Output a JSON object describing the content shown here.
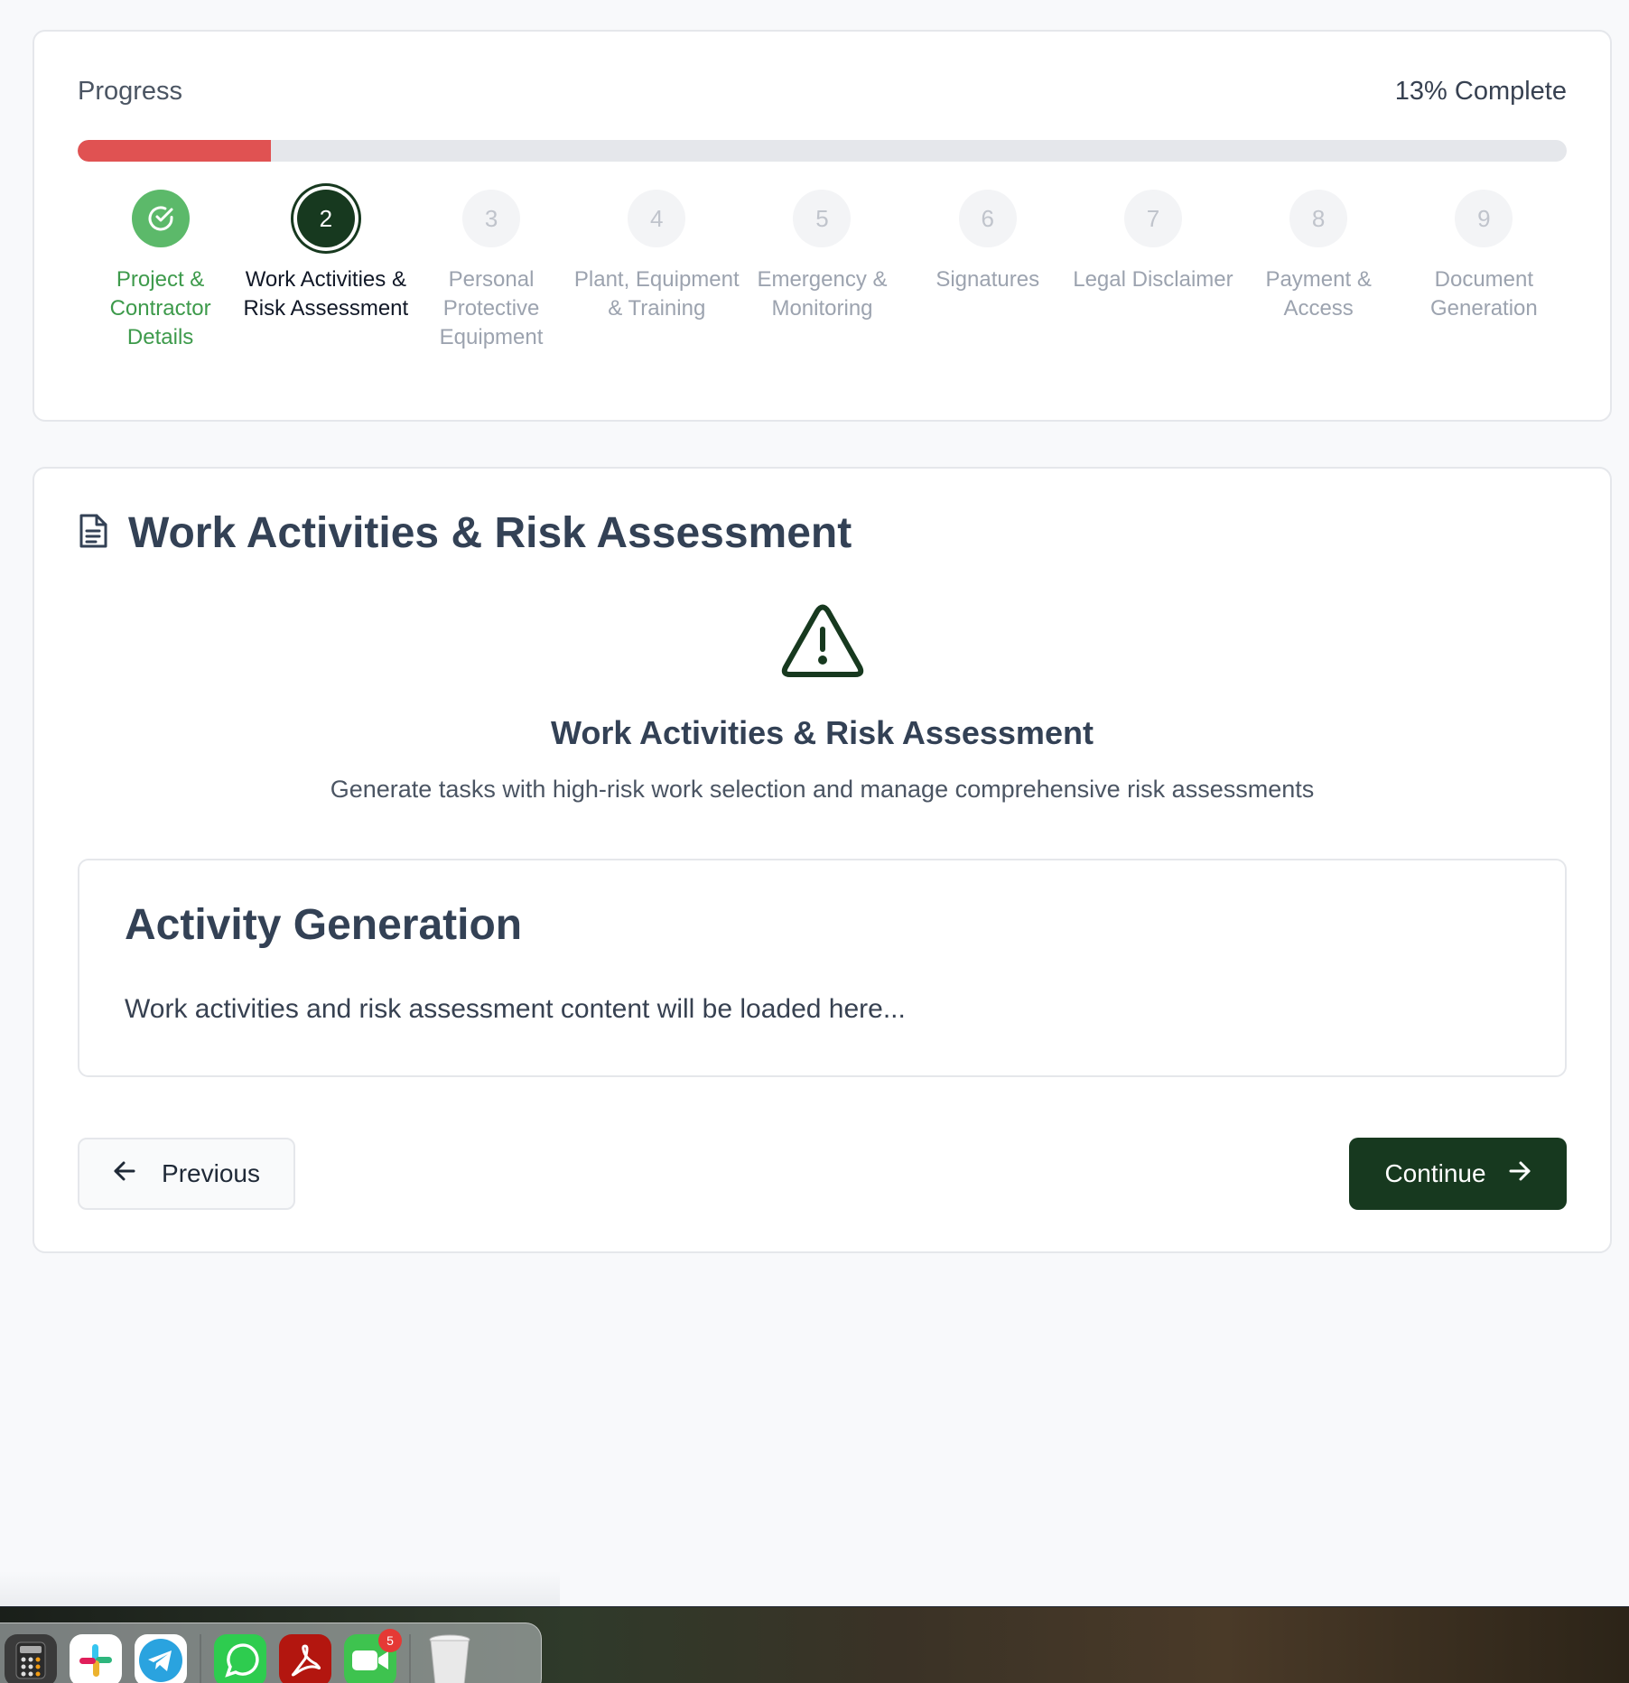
{
  "progress": {
    "label": "Progress",
    "percent_text": "13% Complete",
    "percent": 13,
    "fill_color": "#e05252"
  },
  "steps": [
    {
      "number": "",
      "label": "Project & Contractor Details",
      "state": "done",
      "icon": "check-circle-icon"
    },
    {
      "number": "2",
      "label": "Work Activities & Risk Assessment",
      "state": "active"
    },
    {
      "number": "3",
      "label": "Personal Protective Equipment",
      "state": "pending"
    },
    {
      "number": "4",
      "label": "Plant, Equipment & Training",
      "state": "pending"
    },
    {
      "number": "5",
      "label": "Emergency & Monitoring",
      "state": "pending"
    },
    {
      "number": "6",
      "label": "Signatures",
      "state": "pending"
    },
    {
      "number": "7",
      "label": "Legal Disclaimer",
      "state": "pending"
    },
    {
      "number": "8",
      "label": "Payment & Access",
      "state": "pending"
    },
    {
      "number": "9",
      "label": "Document Generation",
      "state": "pending"
    }
  ],
  "section": {
    "icon": "document-icon",
    "title": "Work Activities & Risk Assessment",
    "hero_icon": "warning-triangle-icon",
    "hero_title": "Work Activities & Risk Assessment",
    "hero_subtitle": "Generate tasks with high-risk work selection and manage comprehensive risk assessments"
  },
  "activity": {
    "title": "Activity Generation",
    "placeholder_text": "Work activities and risk assessment content will be loaded here..."
  },
  "nav": {
    "previous_label": "Previous",
    "continue_label": "Continue"
  },
  "dock": {
    "apps": [
      "calculator-icon",
      "slack-icon",
      "telegram-icon",
      "whatsapp-icon",
      "acrobat-icon",
      "facetime-icon",
      "trash-icon"
    ],
    "facetime_badge": "5"
  },
  "colors": {
    "brand_dark_green": "#17391f",
    "done_green": "#5cb96a",
    "progress_red": "#e05252"
  }
}
